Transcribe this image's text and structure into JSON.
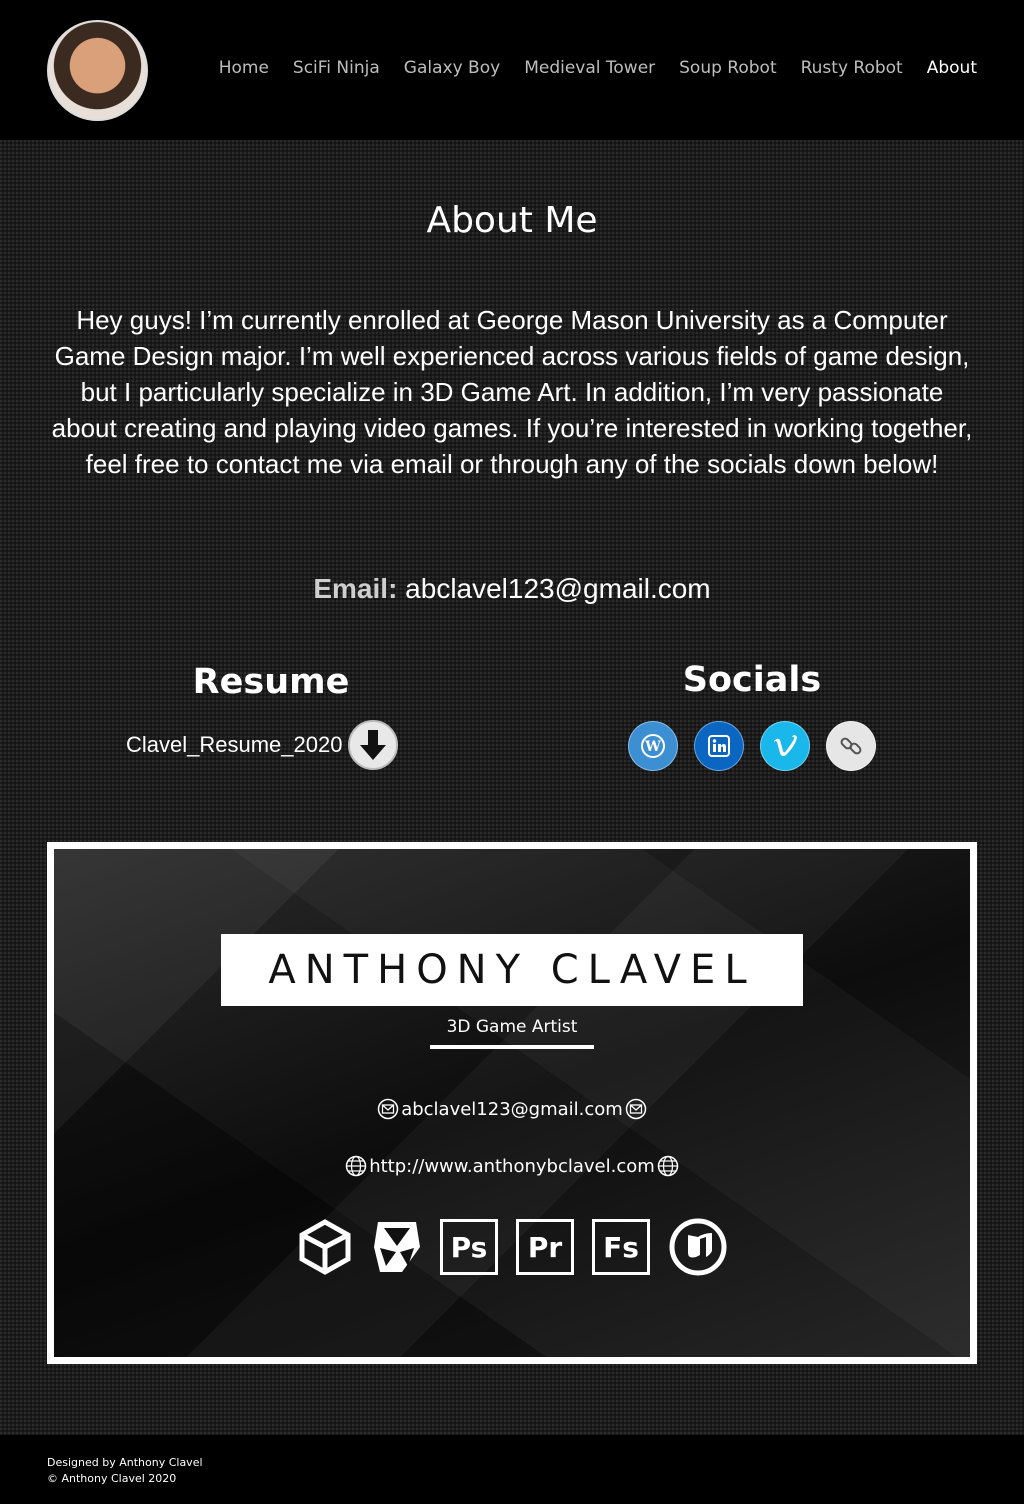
{
  "nav": {
    "items": [
      {
        "label": "Home"
      },
      {
        "label": "SciFi Ninja"
      },
      {
        "label": "Galaxy Boy"
      },
      {
        "label": "Medieval Tower"
      },
      {
        "label": "Soup Robot"
      },
      {
        "label": "Rusty Robot"
      },
      {
        "label": "About",
        "active": true
      }
    ]
  },
  "about": {
    "title": "About Me",
    "intro": "Hey guys! I’m currently enrolled at George Mason University as a Computer Game Design major. I’m well experienced across various fields of game design, but I particularly specialize in 3D Game Art. In addition, I’m very passionate about creating and playing video games. If you’re interested in working together, feel free to contact me via email or through any of the socials down below!",
    "email_label": "Email:",
    "email_value": "abclavel123@gmail.com"
  },
  "resume": {
    "title": "Resume",
    "file_name": "Clavel_Resume_2020",
    "download_icon": "download-arrow-icon"
  },
  "socials": {
    "title": "Socials",
    "items": [
      {
        "icon": "wordpress-icon",
        "color": "#3c8fd3"
      },
      {
        "icon": "linkedin-icon",
        "color": "#0b66c2"
      },
      {
        "icon": "vimeo-icon",
        "color": "#1ab7ea"
      },
      {
        "icon": "link-icon",
        "color": "#e6e6e6"
      }
    ]
  },
  "card": {
    "name": "ANTHONY CLAVEL",
    "role": "3D Game Artist",
    "email": "abclavel123@gmail.com",
    "website": "http://www.anthonybclavel.com",
    "tools": [
      {
        "icon": "unity-icon"
      },
      {
        "icon": "3ds-max-icon"
      },
      {
        "icon": "photoshop-icon",
        "text": "Ps"
      },
      {
        "icon": "premiere-icon",
        "text": "Pr"
      },
      {
        "icon": "fuse-icon",
        "text": "Fs"
      },
      {
        "icon": "unreal-engine-icon"
      }
    ]
  },
  "footer": {
    "designed_by": "Designed by Anthony Clavel",
    "copyright": "© Anthony Clavel 2020"
  }
}
